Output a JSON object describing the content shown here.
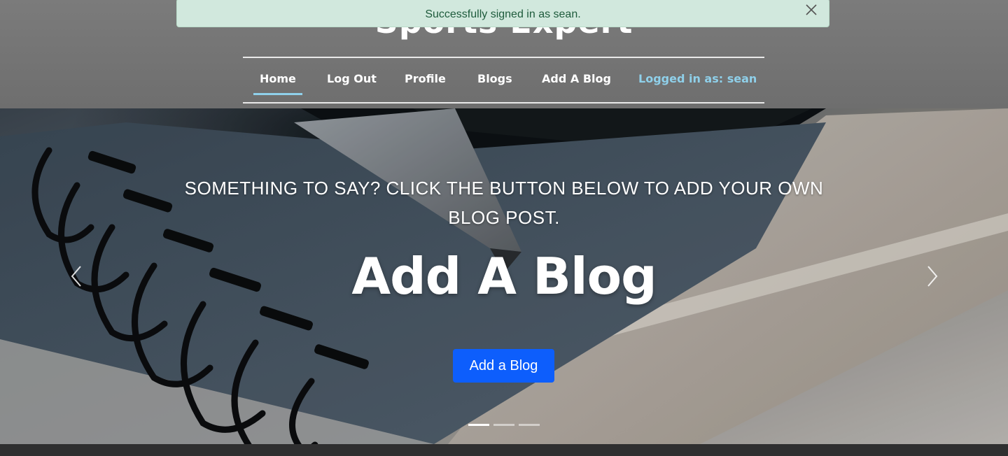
{
  "brand": {
    "name": "Sports Expert"
  },
  "nav": {
    "items": [
      {
        "label": "Home",
        "active": true
      },
      {
        "label": "Log Out"
      },
      {
        "label": "Profile"
      },
      {
        "label": "Blogs"
      },
      {
        "label": "Add A Blog"
      }
    ],
    "user_status": "Logged in as: sean"
  },
  "alert": {
    "message": "Successfully signed in as sean.",
    "close_icon": "close-icon",
    "colors": {
      "background": "#d1e8dd",
      "text": "#1e5b3c"
    }
  },
  "hero": {
    "text": "SOMETHING TO SAY? CLICK THE BUTTON BELOW TO ADD YOUR OWN BLOG POST.",
    "title": "Add A Blog",
    "button_label": "Add a Blog",
    "prev_icon": "chevron-left-icon",
    "next_icon": "chevron-right-icon",
    "slide_count": 3,
    "active_slide": 1,
    "colors": {
      "button": "#0d5efc",
      "nav_active_underline": "#8fd0ea"
    }
  }
}
